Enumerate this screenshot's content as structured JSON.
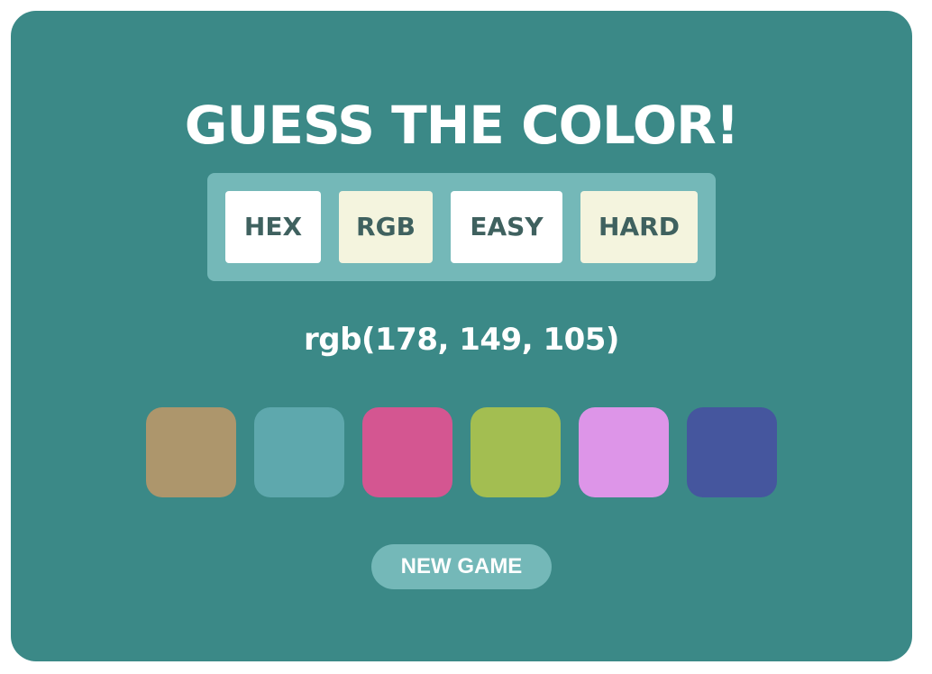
{
  "game": {
    "title": "GUESS THE COLOR!",
    "target_code": "rgb(178, 149, 105)"
  },
  "mode_buttons": [
    {
      "label": "HEX",
      "background": "#ffffff"
    },
    {
      "label": "RGB",
      "background": "#f4f4de"
    },
    {
      "label": "EASY",
      "background": "#ffffff"
    },
    {
      "label": "HARD",
      "background": "#f4f4de"
    }
  ],
  "swatches": [
    {
      "color": "#ad966c"
    },
    {
      "color": "#5ea8ad"
    },
    {
      "color": "#d45691"
    },
    {
      "color": "#a3be51"
    },
    {
      "color": "#dd95e8"
    },
    {
      "color": "#45569e"
    }
  ],
  "actions": {
    "new_game_label": "NEW GAME"
  },
  "theme": {
    "card_background": "#3b8987",
    "panel_background": "#74b8b8",
    "button_text": "#3f615f",
    "text_light": "#ffffff"
  }
}
